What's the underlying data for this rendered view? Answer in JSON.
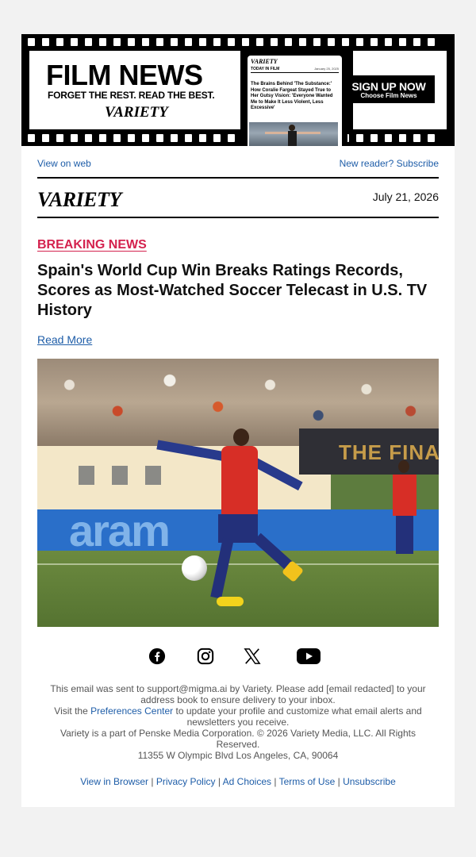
{
  "banner": {
    "title": "FILM NEWS",
    "tagline": "FORGET THE REST. READ THE BEST.",
    "brand": "VARIETY",
    "phone": {
      "brand": "VARIETY",
      "section": "TODAY IN FILM",
      "date": "January 25, 2025",
      "headline": "The Brains Behind 'The Substance:' How Coralie Fargeat Stayed True to Her Gutsy Vision: 'Everyone Wanted Me to Make It Less Violent, Less Excessive'"
    },
    "cta_main": "SIGN UP NOW",
    "cta_sub": "Choose Film News"
  },
  "header": {
    "view_on_web": "View on web",
    "new_reader": "New reader? Subscribe",
    "logo": "VARIETY",
    "date": "July 21, 2026"
  },
  "article": {
    "kicker": "BREAKING NEWS",
    "headline": "Spain's World Cup Win Breaks Ratings Records, Scores as Most-Watched Soccer Telecast in U.S. TV History",
    "read_more": "Read More",
    "photo_signage": {
      "board": "THE FINA",
      "ad": "aram"
    }
  },
  "social": {
    "icons": [
      "facebook-icon",
      "instagram-icon",
      "x-icon",
      "youtube-icon"
    ]
  },
  "footer": {
    "line1_before": "This email was sent to support@migma.ai by Variety. Please add [email redacted] to your address book to ensure delivery to your inbox.",
    "line2_before": "Visit the ",
    "line2_link": "Preferences Center",
    "line2_after": " to update your profile and customize what email alerts and newsletters you receive.",
    "line3": "Variety is a part of Penske Media Corporation. © 2026 Variety Media, LLC. All Rights Reserved.",
    "line4": "11355 W Olympic Blvd Los Angeles, CA, 90064",
    "links": [
      "View in Browser",
      "Privacy Policy",
      "Ad Choices",
      "Terms of Use",
      "Unsubscribe"
    ],
    "separator": " | "
  },
  "colors": {
    "page_bg": "#f2f2f2",
    "card_bg": "#ffffff",
    "link": "#1e5da8",
    "breaking": "#d4224e"
  }
}
